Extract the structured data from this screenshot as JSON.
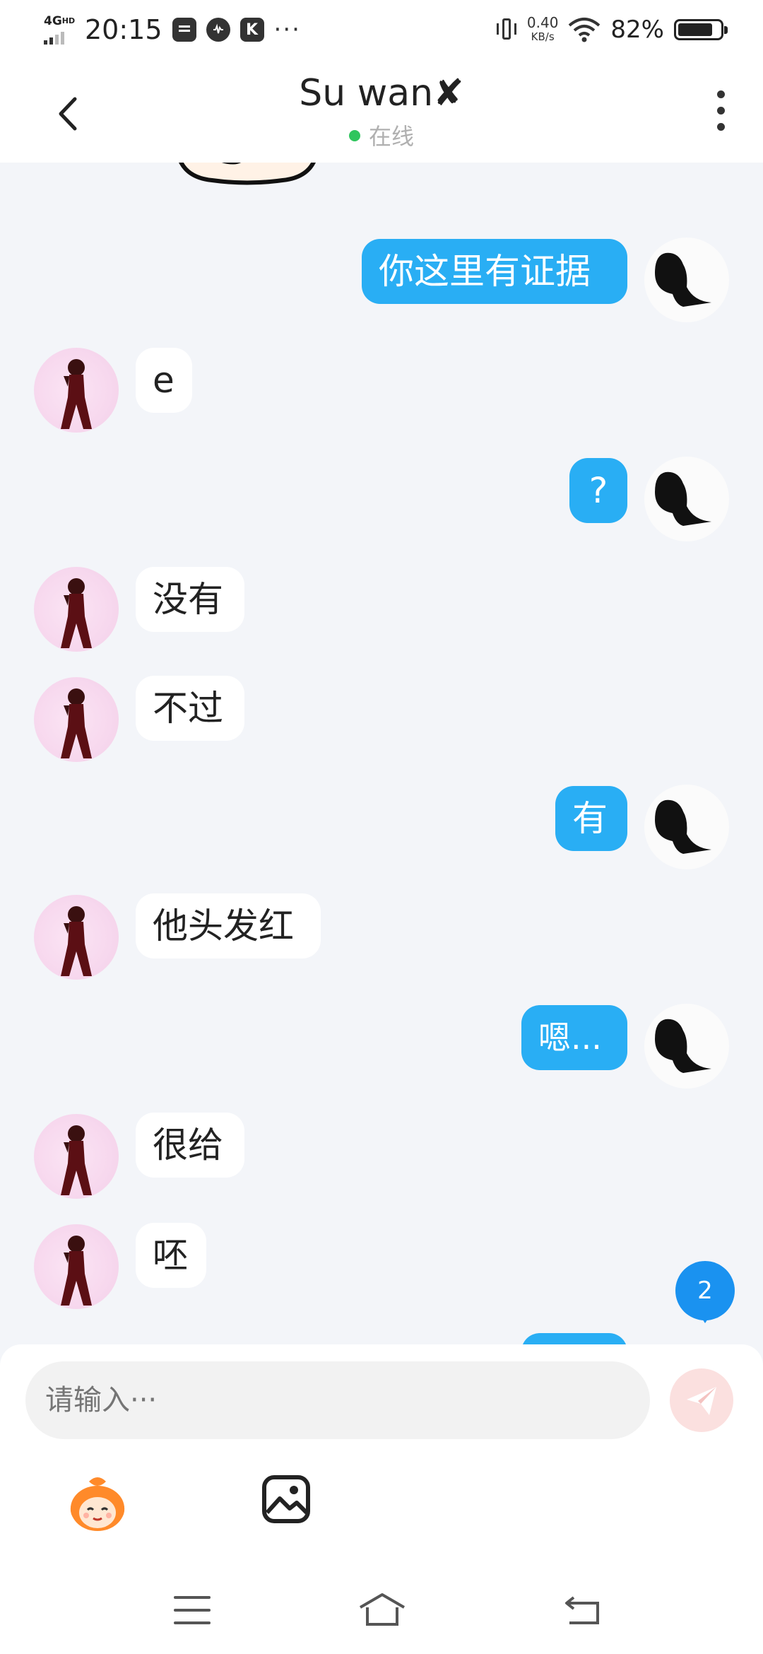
{
  "status_bar": {
    "network": "4G",
    "network_hd": "HD",
    "time": "20:15",
    "speed_value": "0.40",
    "speed_unit": "KB/s",
    "battery": "82%",
    "battery_level": 0.82
  },
  "header": {
    "title": "Su wan",
    "title_mark": "✘",
    "status": "在线"
  },
  "messages": [
    {
      "from": "me",
      "text": "你这里有证据"
    },
    {
      "from": "her",
      "text": "e"
    },
    {
      "from": "me",
      "text": "?"
    },
    {
      "from": "her",
      "text": "没有"
    },
    {
      "from": "her",
      "text": "不过"
    },
    {
      "from": "me",
      "text": "有"
    },
    {
      "from": "her",
      "text": "他头发红"
    },
    {
      "from": "me",
      "text": "嗯..."
    },
    {
      "from": "her",
      "text": "很给"
    },
    {
      "from": "her",
      "text": "呸"
    }
  ],
  "unread_count": "2",
  "composer": {
    "placeholder": "请输入···"
  },
  "colors": {
    "outgoing_bubble": "#29aef4",
    "incoming_bubble": "#ffffff",
    "chat_background": "#f3f5f9",
    "online_dot": "#2fc55d",
    "unread_badge": "#1a92f0",
    "send_button": "#fbe0df"
  },
  "icons": {
    "back": "chevron-left-icon",
    "more": "more-vertical-icon",
    "send": "paper-plane-icon",
    "emoji": "sticker-face-icon",
    "image": "image-icon",
    "nav_menu": "menu-icon",
    "nav_home": "home-icon",
    "nav_back": "return-icon"
  }
}
